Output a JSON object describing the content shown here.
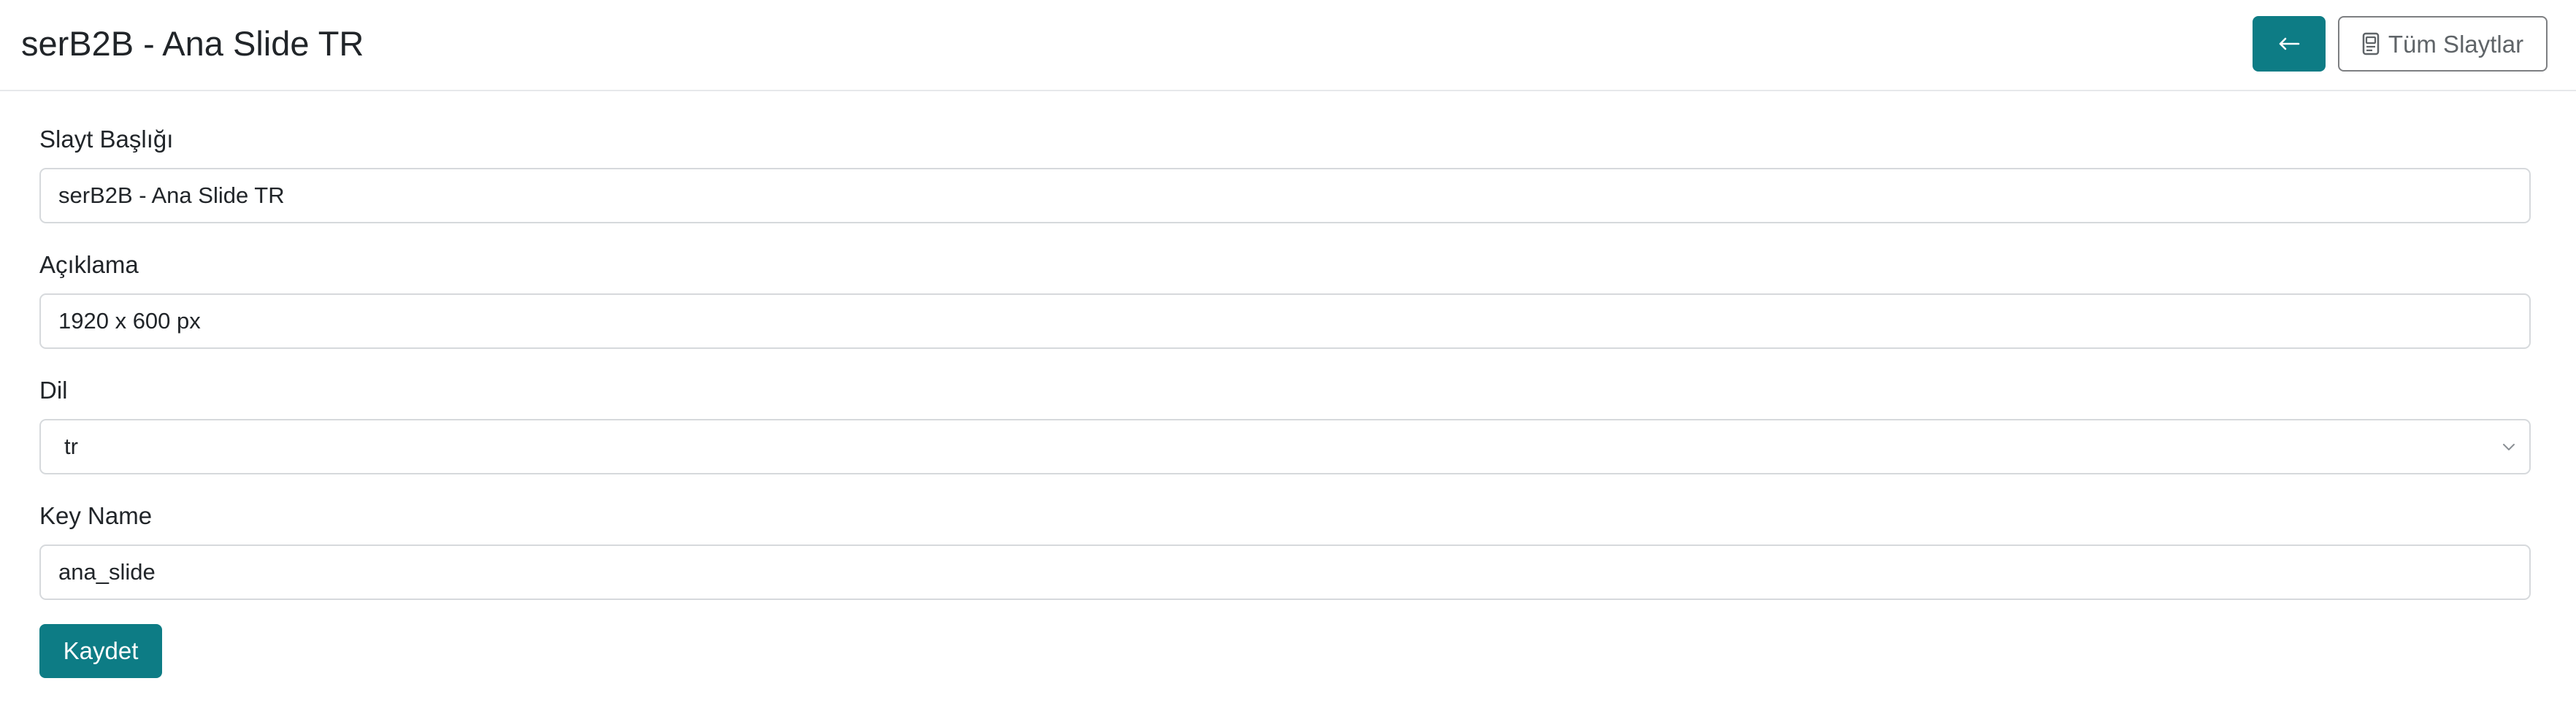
{
  "header": {
    "title": "serB2B - Ana Slide TR",
    "back_button_icon": "arrow-left-icon",
    "all_slides_icon": "document-icon",
    "all_slides_label": "Tüm Slaytlar"
  },
  "form": {
    "title_field": {
      "label": "Slayt Başlığı",
      "value": "serB2B - Ana Slide TR"
    },
    "description_field": {
      "label": "Açıklama",
      "value": "1920 x 600 px"
    },
    "language_field": {
      "label": "Dil",
      "value": "tr",
      "icon": "chevron-down-icon"
    },
    "key_field": {
      "label": "Key Name",
      "value": "ana_slide"
    },
    "save_label": "Kaydet"
  },
  "colors": {
    "primary": "#0d7c85",
    "border": "#d6d9dc",
    "text": "#212529",
    "outline_button_border": "#7d7f82"
  }
}
